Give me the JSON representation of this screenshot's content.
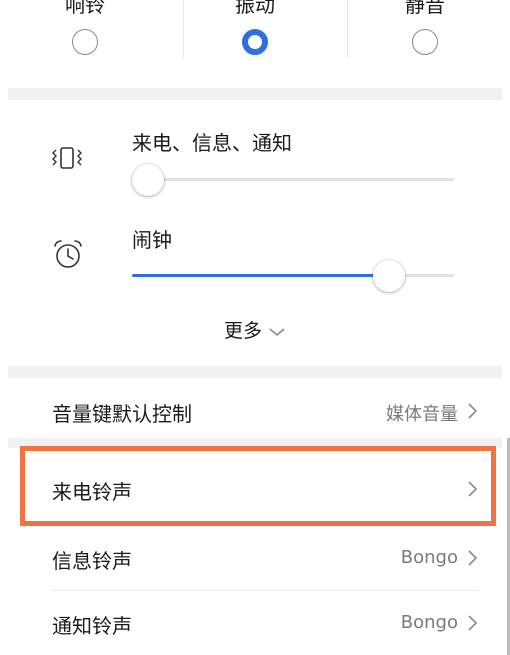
{
  "sound_modes": [
    {
      "label": "响铃",
      "selected": false,
      "icon": "radio-unselected-icon"
    },
    {
      "label": "振动",
      "selected": true,
      "icon": "radio-selected-icon"
    },
    {
      "label": "静音",
      "selected": false,
      "icon": "radio-unselected-icon"
    }
  ],
  "volume": {
    "ringer": {
      "label": "来电、信息、通知",
      "level": 0.0,
      "icon": "vibrate-icon"
    },
    "alarm": {
      "label": "闹钟",
      "level": 0.83,
      "icon": "alarm-clock-icon"
    },
    "more_label": "更多"
  },
  "settings": {
    "volume_key": {
      "label": "音量键默认控制",
      "value": "媒体音量"
    },
    "ringtone": {
      "label": "来电铃声",
      "value": ""
    },
    "message_tone": {
      "label": "信息铃声",
      "value": "Bongo"
    },
    "notification_tone": {
      "label": "通知铃声",
      "value": "Bongo"
    }
  },
  "colors": {
    "accent": "#2f6fde",
    "highlight_border": "#ef7444",
    "section_gap": "#f1f1f1"
  }
}
